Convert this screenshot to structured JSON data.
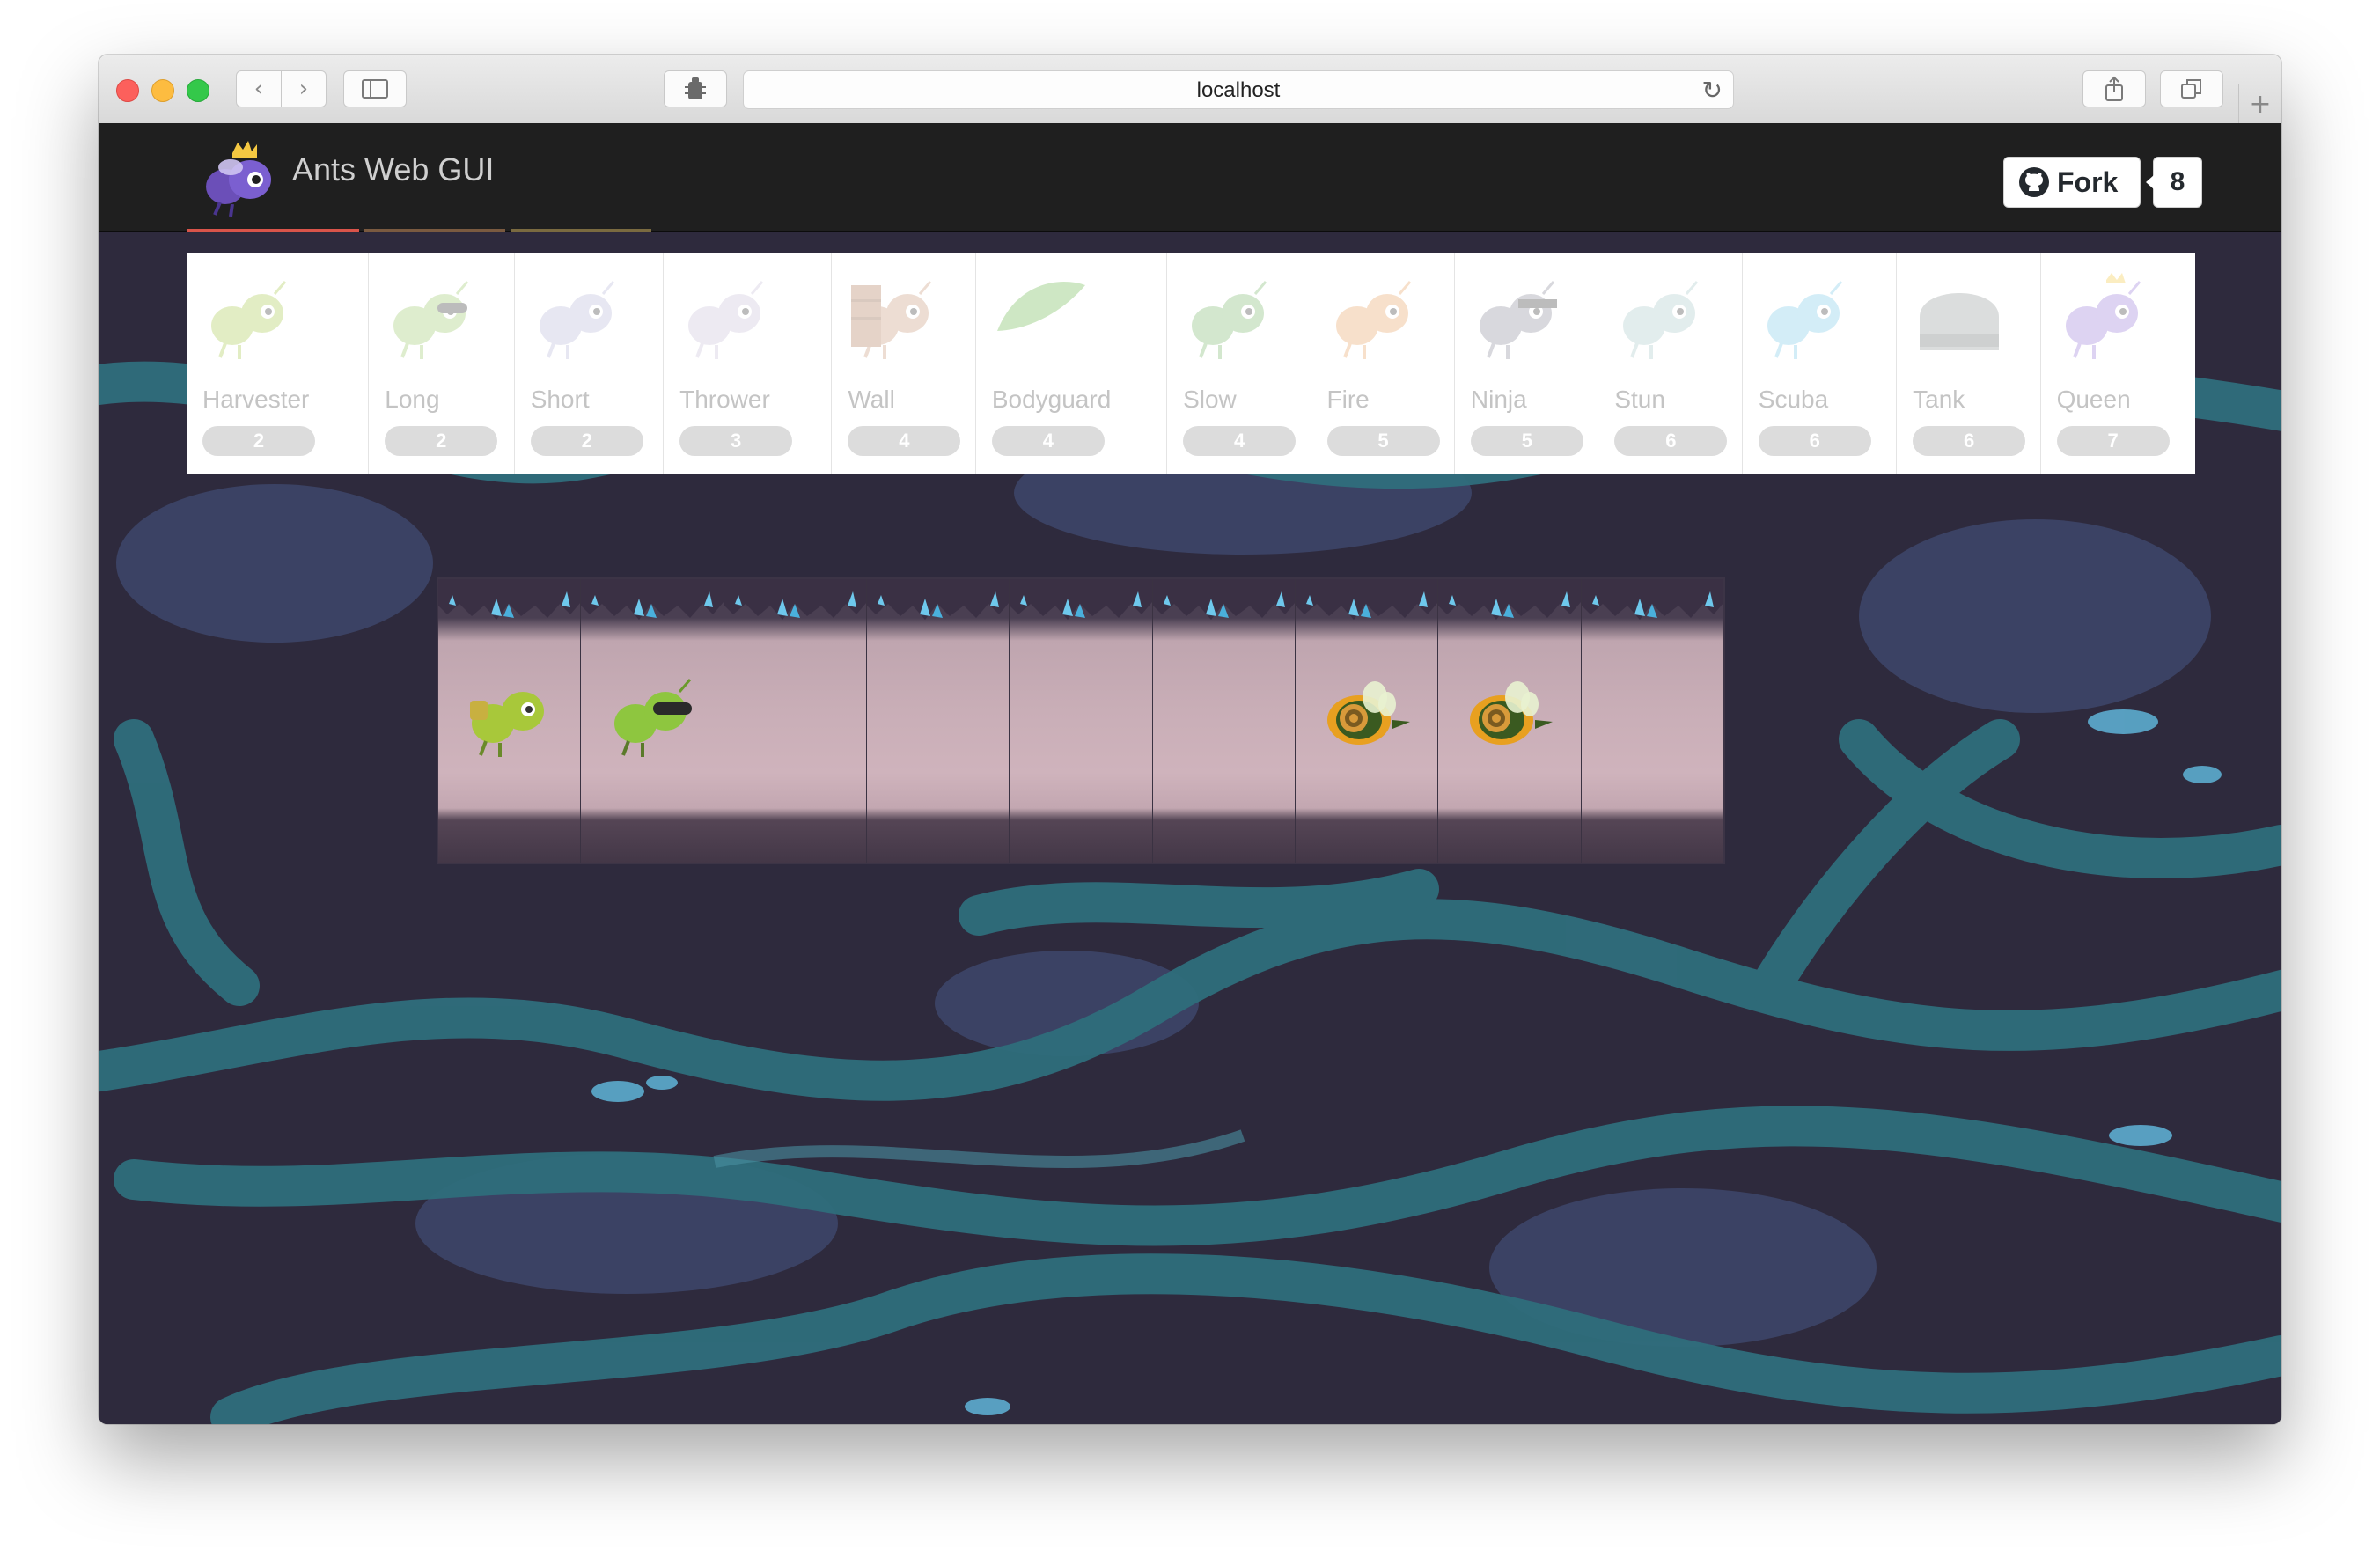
{
  "browser": {
    "url": "localhost",
    "buttons": {
      "back": "back-arrow-icon",
      "forward": "forward-arrow-icon",
      "sidebar": "sidebar-icon",
      "extension": "extension-icon",
      "reload": "reload-icon",
      "share": "share-icon",
      "tabs": "tabs-icon",
      "new_tab": "plus-icon"
    }
  },
  "app": {
    "title": "Ants Web GUI",
    "logo": "queen-ant-logo",
    "fork": {
      "label": "Fork",
      "count": "8",
      "icon": "github-icon"
    }
  },
  "ants": [
    {
      "name": "Harvester",
      "cost": "2",
      "color": "#a8c94a",
      "icon": "harvester-ant-icon"
    },
    {
      "name": "Long",
      "cost": "2",
      "color": "#9cc96a",
      "icon": "long-thrower-ant-icon"
    },
    {
      "name": "Short",
      "cost": "2",
      "color": "#b8b8d8",
      "icon": "short-thrower-ant-icon"
    },
    {
      "name": "Thrower",
      "cost": "3",
      "color": "#c8c0d8",
      "icon": "thrower-ant-icon"
    },
    {
      "name": "Wall",
      "cost": "4",
      "color": "#c89878",
      "icon": "wall-ant-icon"
    },
    {
      "name": "Bodyguard",
      "cost": "4",
      "color": "#6ab84a",
      "icon": "bodyguard-ant-icon"
    },
    {
      "name": "Slow",
      "cost": "4",
      "color": "#78b868",
      "icon": "slow-thrower-ant-icon"
    },
    {
      "name": "Fire",
      "cost": "5",
      "color": "#e8a060",
      "icon": "fire-ant-icon"
    },
    {
      "name": "Ninja",
      "cost": "5",
      "color": "#888898",
      "icon": "ninja-ant-icon"
    },
    {
      "name": "Stun",
      "cost": "6",
      "color": "#a8c8c8",
      "icon": "stun-thrower-ant-icon"
    },
    {
      "name": "Scuba",
      "cost": "6",
      "color": "#78c8e8",
      "icon": "scuba-thrower-ant-icon"
    },
    {
      "name": "Tank",
      "cost": "6",
      "color": "#909898",
      "icon": "tank-ant-icon"
    },
    {
      "name": "Queen",
      "cost": "7",
      "color": "#9878d8",
      "icon": "queen-ant-icon"
    }
  ],
  "tunnel": {
    "places": [
      {
        "occupant": "harvester-ant-icon"
      },
      {
        "occupant": "long-thrower-ant-icon"
      },
      {
        "occupant": ""
      },
      {
        "occupant": ""
      },
      {
        "occupant": ""
      },
      {
        "occupant": ""
      },
      {
        "occupant": "bee-icon"
      },
      {
        "occupant": "bee-icon"
      },
      {
        "occupant": ""
      }
    ]
  },
  "colors": {
    "navbar": "#1f1f1f",
    "tab_indicators": [
      "#e05a4e",
      "#e07a3e",
      "#e0a23e"
    ],
    "cost_pill": "#dcdcdc",
    "background": "#2e2a3d",
    "tunnel_channel": "#2f6e7c"
  }
}
